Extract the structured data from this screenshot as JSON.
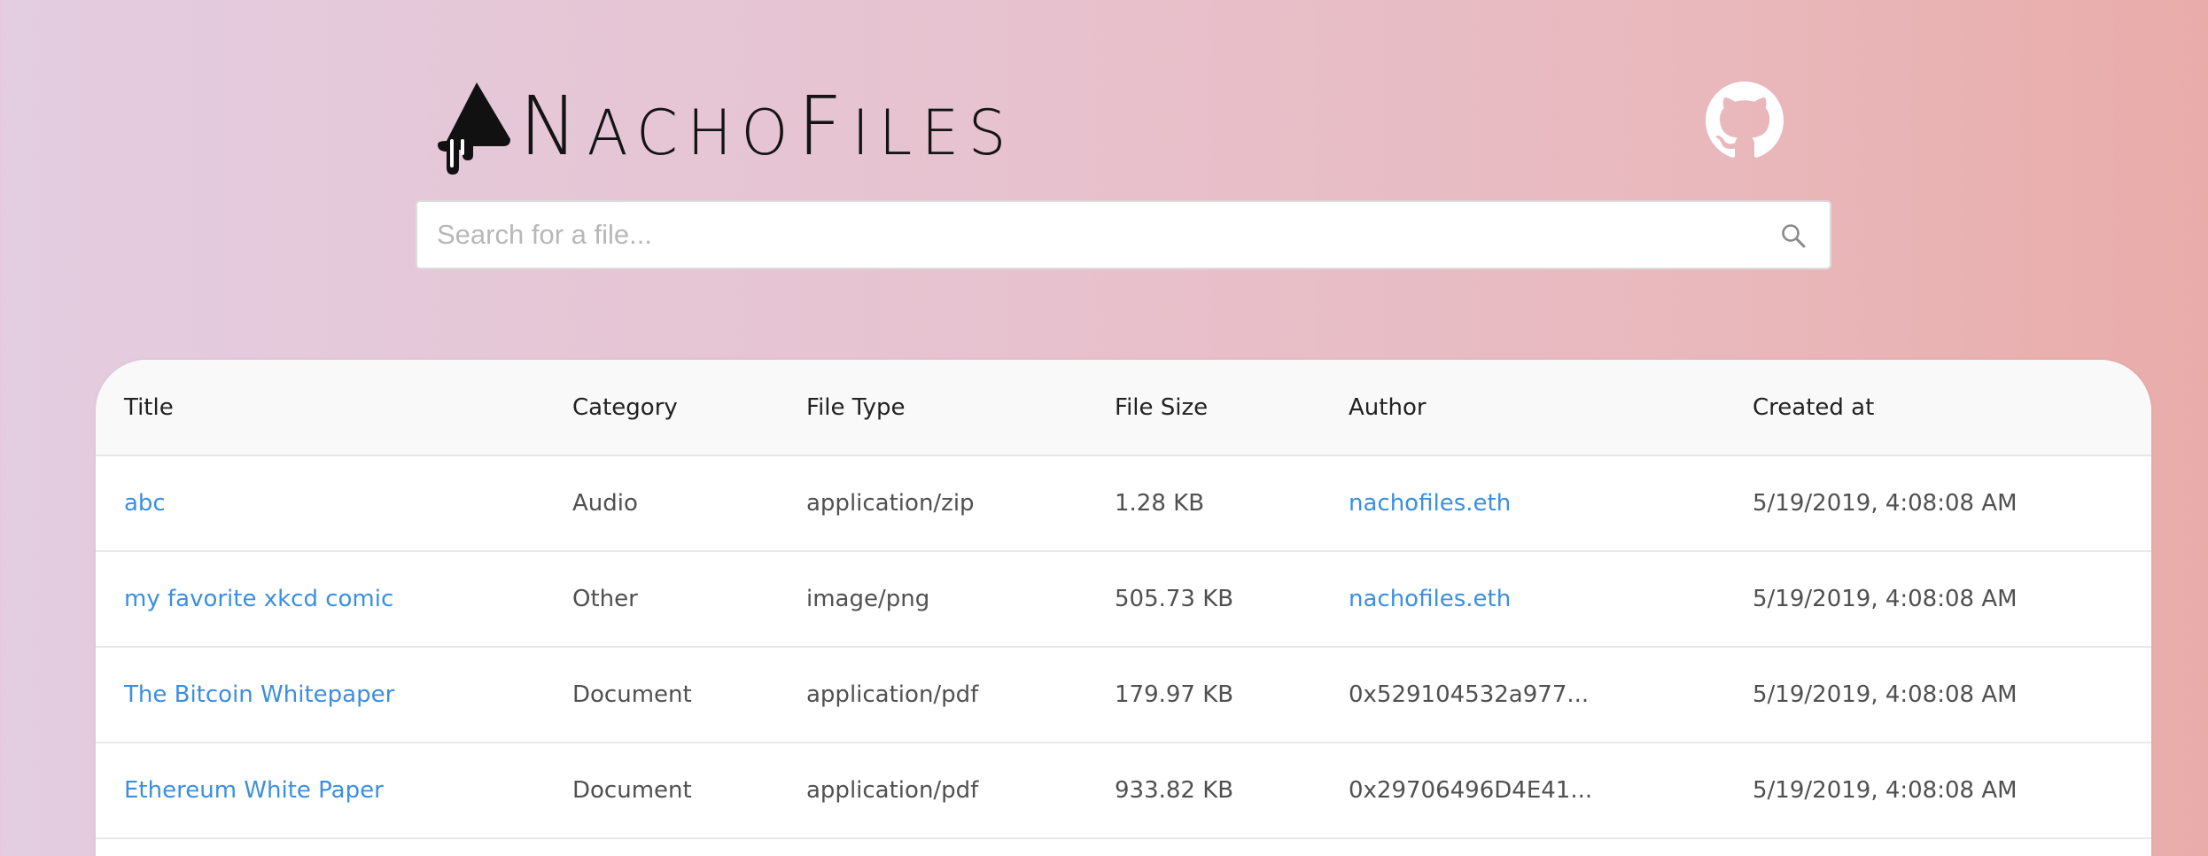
{
  "brand": {
    "name_parts": [
      "N",
      "acho",
      "F",
      "iles"
    ],
    "logo_icon": "nacho-drip-logo-icon"
  },
  "github": {
    "icon": "github-icon"
  },
  "search": {
    "placeholder": "Search for a file...",
    "value": "",
    "icon": "search-icon"
  },
  "table": {
    "columns": [
      "Title",
      "Category",
      "File Type",
      "File Size",
      "Author",
      "Created at"
    ],
    "rows": [
      {
        "title": "abc",
        "category": "Audio",
        "file_type": "application/zip",
        "file_size": "1.28 KB",
        "author": "nachofiles.eth",
        "created_at": "5/19/2019, 4:08:08 AM"
      },
      {
        "title": "my favorite xkcd comic",
        "category": "Other",
        "file_type": "image/png",
        "file_size": "505.73 KB",
        "author": "nachofiles.eth",
        "created_at": "5/19/2019, 4:08:08 AM"
      },
      {
        "title": "The Bitcoin Whitepaper",
        "category": "Document",
        "file_type": "application/pdf",
        "file_size": "179.97 KB",
        "author": "0x529104532a977...",
        "created_at": "5/19/2019, 4:08:08 AM"
      },
      {
        "title": "Ethereum White Paper",
        "category": "Document",
        "file_type": "application/pdf",
        "file_size": "933.82 KB",
        "author": "0x29706496D4E41...",
        "created_at": "5/19/2019, 4:08:08 AM"
      }
    ]
  },
  "colors": {
    "link": "#3b8fe0",
    "text": "#505050",
    "brand": "#141414",
    "gradient_left": "#e3cde0",
    "gradient_right": "#e9aca9"
  }
}
